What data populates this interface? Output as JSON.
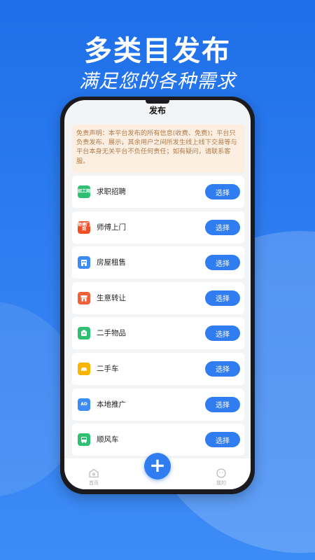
{
  "banner": {
    "headline": "多类目发布",
    "subline": "满足您的各种需求"
  },
  "page": {
    "title": "发布"
  },
  "disclaimer": "免责声明：本平台发布的所有信息(收费、免费)；平台只负责发布、展示，其余用户之间所发生线上线下交易等与平台本身无关平台不负任何责任；如有疑问，请联系客服。",
  "categories": [
    {
      "label": "求职招聘",
      "button": "选择",
      "icon": "job-icon",
      "icon_text": "招工网",
      "color": "#2fbf71"
    },
    {
      "label": "师傅上门",
      "button": "选择",
      "icon": "worker-icon",
      "icon_text": "师傅门到",
      "color": "#f04e23"
    },
    {
      "label": "房屋租售",
      "button": "选择",
      "icon": "house-icon",
      "icon_text": "",
      "color": "#3d8bf5"
    },
    {
      "label": "生意转让",
      "button": "选择",
      "icon": "shop-icon",
      "icon_text": "",
      "color": "#f0613a"
    },
    {
      "label": "二手物品",
      "button": "选择",
      "icon": "goods-icon",
      "icon_text": "",
      "color": "#2fbf71"
    },
    {
      "label": "二手车",
      "button": "选择",
      "icon": "car-icon",
      "icon_text": "",
      "color": "#f7b500"
    },
    {
      "label": "本地推广",
      "button": "选择",
      "icon": "ad-icon",
      "icon_text": "AD",
      "color": "#3d8bf5"
    },
    {
      "label": "顺风车",
      "button": "选择",
      "icon": "bus-icon",
      "icon_text": "",
      "color": "#2fbf71"
    }
  ],
  "tabbar": {
    "home": "首页",
    "mine": "我的",
    "fab": "+"
  },
  "colors": {
    "accent": "#2f7df0",
    "disclaimer_bg": "#fcefe1",
    "disclaimer_text": "#b07a4a"
  }
}
